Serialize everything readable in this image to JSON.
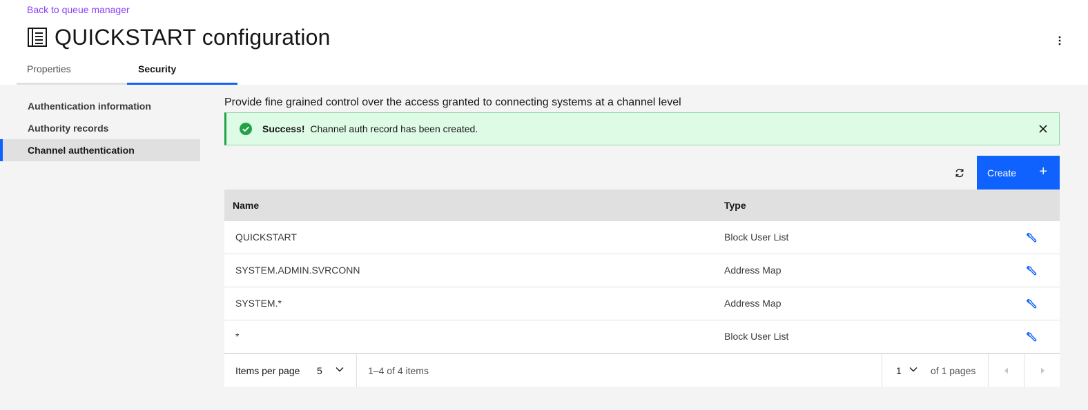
{
  "header": {
    "back_link": "Back to queue manager",
    "title": "QUICKSTART configuration",
    "overflow_icon": "overflow-menu-vertical-icon"
  },
  "tabs": [
    {
      "label": "Properties",
      "active": false
    },
    {
      "label": "Security",
      "active": true
    }
  ],
  "sidenav": {
    "items": [
      {
        "label": "Authentication information",
        "active": false
      },
      {
        "label": "Authority records",
        "active": false
      },
      {
        "label": "Channel authentication",
        "active": true
      }
    ]
  },
  "main": {
    "description": "Provide fine grained control over the access granted to connecting systems at a channel level",
    "notification": {
      "title": "Success!",
      "message": "Channel auth record has been created.",
      "kind": "success"
    },
    "toolbar": {
      "refresh_icon": "refresh-icon",
      "create_label": "Create",
      "create_icon": "+"
    },
    "table": {
      "headers": {
        "name": "Name",
        "type": "Type"
      },
      "rows": [
        {
          "name": "QUICKSTART",
          "type": "Block User List"
        },
        {
          "name": "SYSTEM.ADMIN.SVRCONN",
          "type": "Address Map"
        },
        {
          "name": "SYSTEM.*",
          "type": "Address Map"
        },
        {
          "name": "*",
          "type": "Block User List"
        }
      ]
    },
    "pagination": {
      "items_per_page_label": "Items per page",
      "items_per_page_value": "5",
      "range_text": "1–4 of 4 items",
      "current_page": "1",
      "of_pages_text": "of 1 pages"
    }
  },
  "colors": {
    "primary": "#0f62fe",
    "success": "#24a148",
    "success_bg": "#defbe6",
    "link": "#8a3ffc"
  }
}
